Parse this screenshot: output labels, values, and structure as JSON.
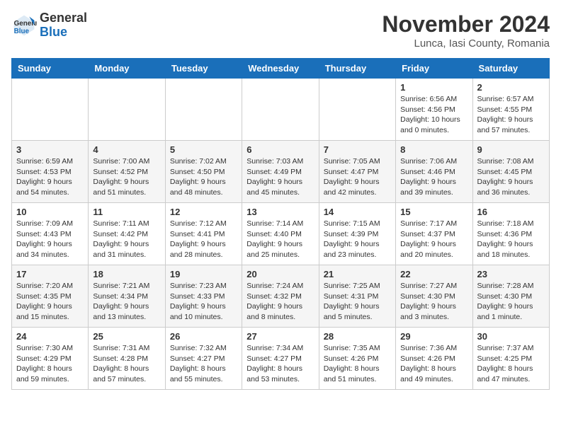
{
  "logo": {
    "general": "General",
    "blue": "Blue"
  },
  "title": "November 2024",
  "location": "Lunca, Iasi County, Romania",
  "days_of_week": [
    "Sunday",
    "Monday",
    "Tuesday",
    "Wednesday",
    "Thursday",
    "Friday",
    "Saturday"
  ],
  "weeks": [
    [
      {
        "day": "",
        "info": ""
      },
      {
        "day": "",
        "info": ""
      },
      {
        "day": "",
        "info": ""
      },
      {
        "day": "",
        "info": ""
      },
      {
        "day": "",
        "info": ""
      },
      {
        "day": "1",
        "info": "Sunrise: 6:56 AM\nSunset: 4:56 PM\nDaylight: 10 hours and 0 minutes."
      },
      {
        "day": "2",
        "info": "Sunrise: 6:57 AM\nSunset: 4:55 PM\nDaylight: 9 hours and 57 minutes."
      }
    ],
    [
      {
        "day": "3",
        "info": "Sunrise: 6:59 AM\nSunset: 4:53 PM\nDaylight: 9 hours and 54 minutes."
      },
      {
        "day": "4",
        "info": "Sunrise: 7:00 AM\nSunset: 4:52 PM\nDaylight: 9 hours and 51 minutes."
      },
      {
        "day": "5",
        "info": "Sunrise: 7:02 AM\nSunset: 4:50 PM\nDaylight: 9 hours and 48 minutes."
      },
      {
        "day": "6",
        "info": "Sunrise: 7:03 AM\nSunset: 4:49 PM\nDaylight: 9 hours and 45 minutes."
      },
      {
        "day": "7",
        "info": "Sunrise: 7:05 AM\nSunset: 4:47 PM\nDaylight: 9 hours and 42 minutes."
      },
      {
        "day": "8",
        "info": "Sunrise: 7:06 AM\nSunset: 4:46 PM\nDaylight: 9 hours and 39 minutes."
      },
      {
        "day": "9",
        "info": "Sunrise: 7:08 AM\nSunset: 4:45 PM\nDaylight: 9 hours and 36 minutes."
      }
    ],
    [
      {
        "day": "10",
        "info": "Sunrise: 7:09 AM\nSunset: 4:43 PM\nDaylight: 9 hours and 34 minutes."
      },
      {
        "day": "11",
        "info": "Sunrise: 7:11 AM\nSunset: 4:42 PM\nDaylight: 9 hours and 31 minutes."
      },
      {
        "day": "12",
        "info": "Sunrise: 7:12 AM\nSunset: 4:41 PM\nDaylight: 9 hours and 28 minutes."
      },
      {
        "day": "13",
        "info": "Sunrise: 7:14 AM\nSunset: 4:40 PM\nDaylight: 9 hours and 25 minutes."
      },
      {
        "day": "14",
        "info": "Sunrise: 7:15 AM\nSunset: 4:39 PM\nDaylight: 9 hours and 23 minutes."
      },
      {
        "day": "15",
        "info": "Sunrise: 7:17 AM\nSunset: 4:37 PM\nDaylight: 9 hours and 20 minutes."
      },
      {
        "day": "16",
        "info": "Sunrise: 7:18 AM\nSunset: 4:36 PM\nDaylight: 9 hours and 18 minutes."
      }
    ],
    [
      {
        "day": "17",
        "info": "Sunrise: 7:20 AM\nSunset: 4:35 PM\nDaylight: 9 hours and 15 minutes."
      },
      {
        "day": "18",
        "info": "Sunrise: 7:21 AM\nSunset: 4:34 PM\nDaylight: 9 hours and 13 minutes."
      },
      {
        "day": "19",
        "info": "Sunrise: 7:23 AM\nSunset: 4:33 PM\nDaylight: 9 hours and 10 minutes."
      },
      {
        "day": "20",
        "info": "Sunrise: 7:24 AM\nSunset: 4:32 PM\nDaylight: 9 hours and 8 minutes."
      },
      {
        "day": "21",
        "info": "Sunrise: 7:25 AM\nSunset: 4:31 PM\nDaylight: 9 hours and 5 minutes."
      },
      {
        "day": "22",
        "info": "Sunrise: 7:27 AM\nSunset: 4:30 PM\nDaylight: 9 hours and 3 minutes."
      },
      {
        "day": "23",
        "info": "Sunrise: 7:28 AM\nSunset: 4:30 PM\nDaylight: 9 hours and 1 minute."
      }
    ],
    [
      {
        "day": "24",
        "info": "Sunrise: 7:30 AM\nSunset: 4:29 PM\nDaylight: 8 hours and 59 minutes."
      },
      {
        "day": "25",
        "info": "Sunrise: 7:31 AM\nSunset: 4:28 PM\nDaylight: 8 hours and 57 minutes."
      },
      {
        "day": "26",
        "info": "Sunrise: 7:32 AM\nSunset: 4:27 PM\nDaylight: 8 hours and 55 minutes."
      },
      {
        "day": "27",
        "info": "Sunrise: 7:34 AM\nSunset: 4:27 PM\nDaylight: 8 hours and 53 minutes."
      },
      {
        "day": "28",
        "info": "Sunrise: 7:35 AM\nSunset: 4:26 PM\nDaylight: 8 hours and 51 minutes."
      },
      {
        "day": "29",
        "info": "Sunrise: 7:36 AM\nSunset: 4:26 PM\nDaylight: 8 hours and 49 minutes."
      },
      {
        "day": "30",
        "info": "Sunrise: 7:37 AM\nSunset: 4:25 PM\nDaylight: 8 hours and 47 minutes."
      }
    ]
  ]
}
